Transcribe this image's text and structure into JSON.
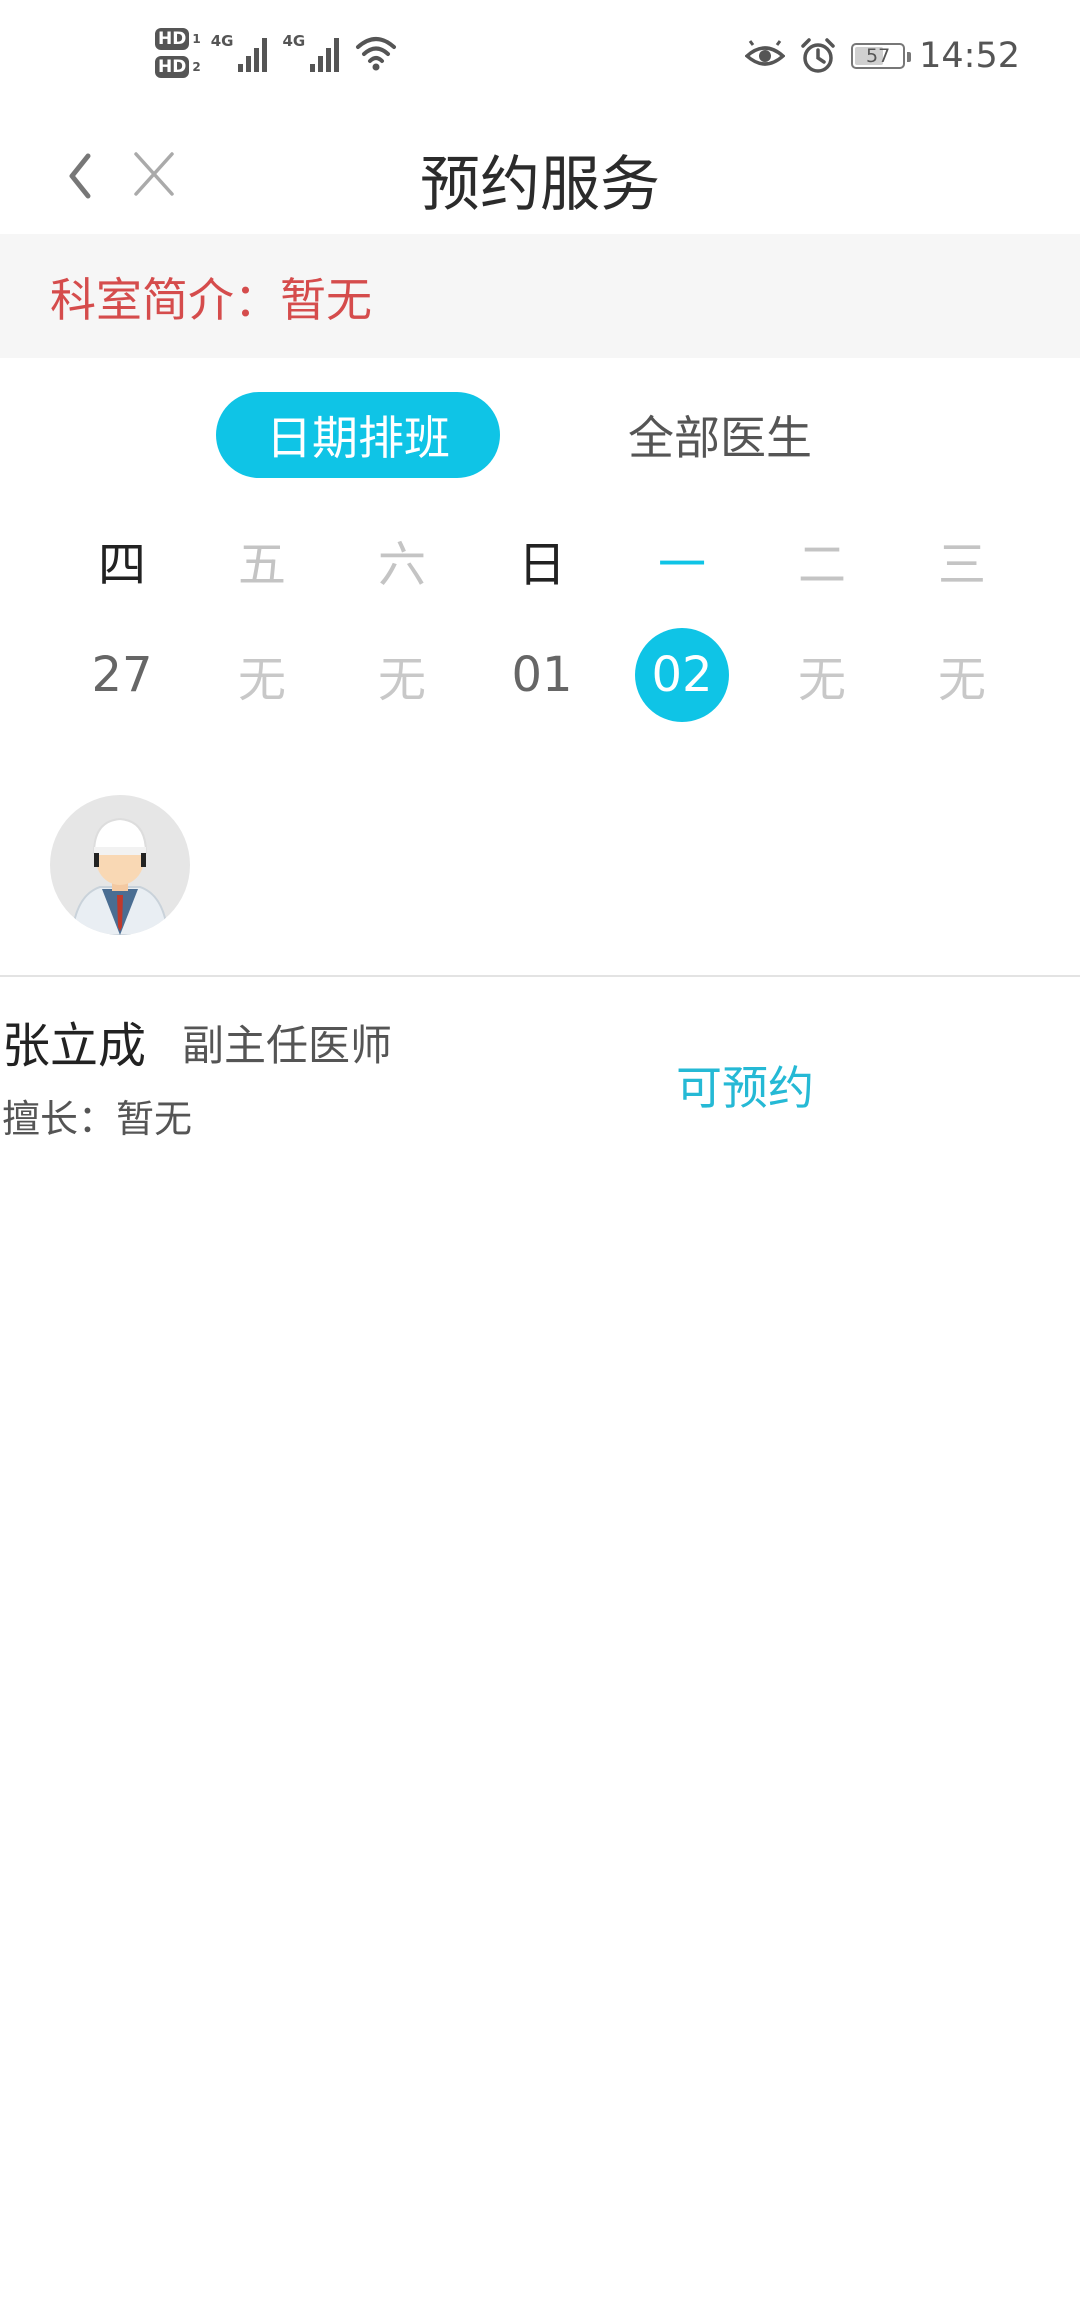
{
  "status_bar": {
    "sim1": "HD",
    "sim1_index": "1",
    "sim2": "HD",
    "sim2_index": "2",
    "net1": "4G",
    "net2": "4G",
    "battery": "57",
    "time": "14:52",
    "icons": [
      "eye-icon",
      "alarm-icon",
      "wifi-icon",
      "signal-icon"
    ]
  },
  "nav": {
    "title": "预约服务",
    "back_icon": "chevron-left-icon",
    "close_icon": "close-icon"
  },
  "intro": {
    "text": "科室简介：暂无",
    "color": "#d54c4c"
  },
  "tabs": {
    "active": "日期排班",
    "inactive": "全部医生",
    "accent": "#0fc4e6"
  },
  "calendar": {
    "weekdays": [
      "四",
      "五",
      "六",
      "日",
      "一",
      "二",
      "三"
    ],
    "dates": [
      "27",
      "无",
      "无",
      "01",
      "02",
      "无",
      "无"
    ],
    "selected_index": 4
  },
  "doctor": {
    "name": "张立成",
    "title": "副主任医师",
    "specialty": "擅长：暂无",
    "status": "可预约",
    "avatar_icon": "doctor-avatar-icon"
  }
}
